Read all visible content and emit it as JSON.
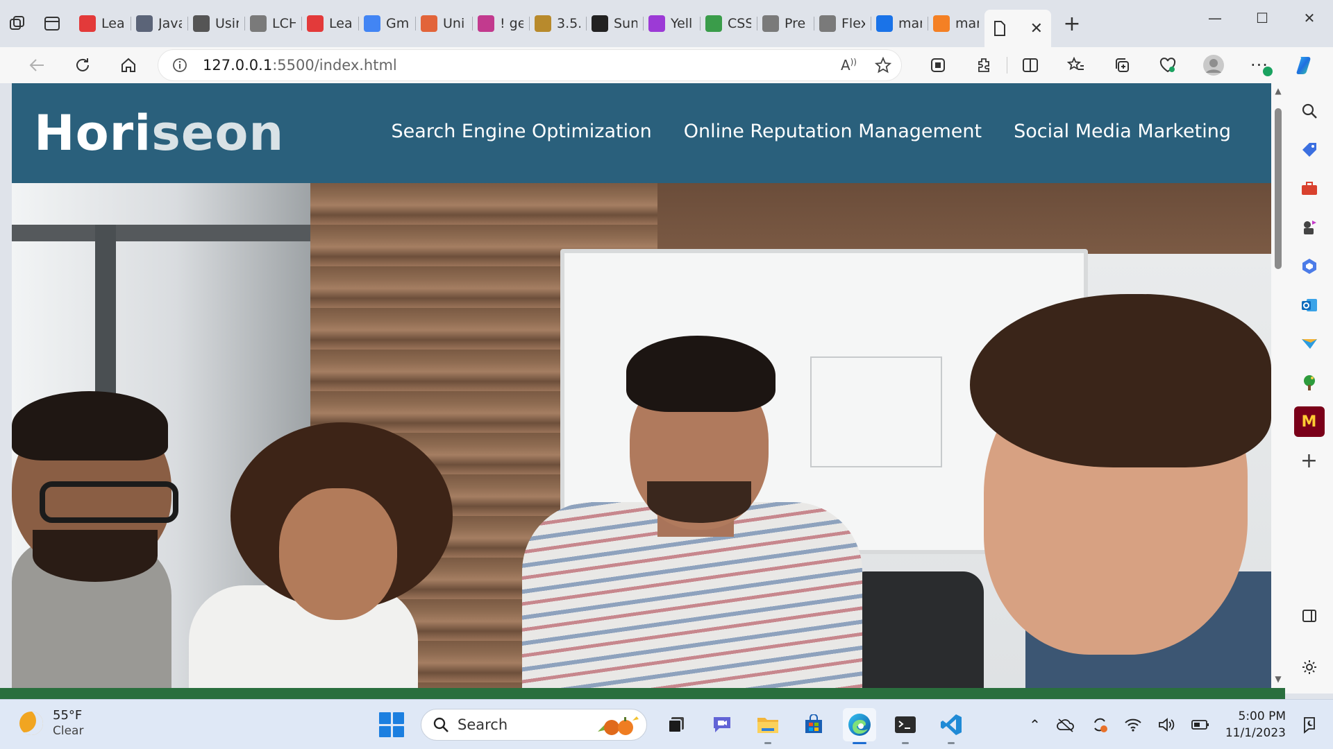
{
  "browser": {
    "tabs": [
      {
        "title": "Lea",
        "favicon": "youtube-icon",
        "color": "#e33a3a"
      },
      {
        "title": "Java",
        "favicon": "x-box-icon",
        "color": "#5b6478"
      },
      {
        "title": "Usir",
        "favicon": "m-logo-icon",
        "color": "#555555"
      },
      {
        "title": "LCH",
        "favicon": "page-icon",
        "color": "#7a7a7a"
      },
      {
        "title": "Lea",
        "favicon": "youtube-icon",
        "color": "#e33a3a"
      },
      {
        "title": "Gm",
        "favicon": "google-icon",
        "color": "#4285f4"
      },
      {
        "title": "Uni",
        "favicon": "gitlab-icon",
        "color": "#e2643a"
      },
      {
        "title": "! ge",
        "favicon": "slack-icon",
        "color": "#c23a8e"
      },
      {
        "title": "3.5.",
        "favicon": "gopher-icon",
        "color": "#b88a2c"
      },
      {
        "title": "Sun",
        "favicon": "github-icon",
        "color": "#222222"
      },
      {
        "title": "Yell",
        "favicon": "color-wheel-icon",
        "color": "#9c3ad6"
      },
      {
        "title": "CSS",
        "favicon": "w3-icon",
        "color": "#3a9c4a"
      },
      {
        "title": "Pre",
        "favicon": "page-icon",
        "color": "#7a7a7a"
      },
      {
        "title": "Flex",
        "favicon": "page-icon",
        "color": "#7a7a7a"
      },
      {
        "title": "mar",
        "favicon": "search-icon",
        "color": "#1a73e8"
      },
      {
        "title": "mar",
        "favicon": "stackoverflow-icon",
        "color": "#f48024"
      }
    ],
    "url_host": "127.0.0.1",
    "url_rest": ":5500/index.html"
  },
  "site": {
    "logo_main": "Hori",
    "logo_accent": "seon",
    "nav": [
      "Search Engine Optimization",
      "Online Reputation Management",
      "Social Media Marketing"
    ]
  },
  "taskbar": {
    "weather_temp": "55°F",
    "weather_cond": "Clear",
    "search_placeholder": "Search",
    "time": "5:00 PM",
    "date": "11/1/2023"
  }
}
